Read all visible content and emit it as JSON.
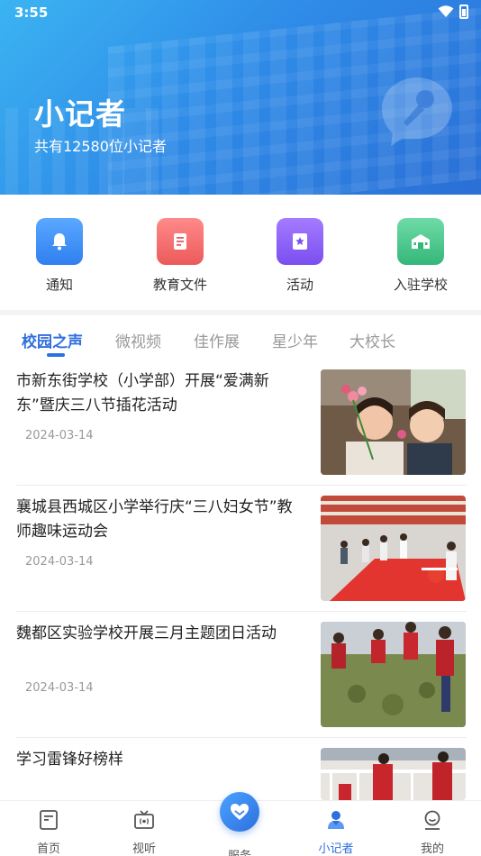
{
  "status_bar": {
    "time": "3:55"
  },
  "header": {
    "title": "小记者",
    "subtitle": "共有12580位小记者"
  },
  "quick_links": [
    {
      "label": "通知",
      "icon": "bell-icon",
      "color": "#3b8cf0"
    },
    {
      "label": "教育文件",
      "icon": "document-icon",
      "color": "#f06a6a"
    },
    {
      "label": "活动",
      "icon": "star-bookmark-icon",
      "color": "#8a5cf0"
    },
    {
      "label": "入驻学校",
      "icon": "school-icon",
      "color": "#3fc48a"
    }
  ],
  "tabs": [
    {
      "label": "校园之声",
      "active": true
    },
    {
      "label": "微视频",
      "active": false
    },
    {
      "label": "佳作展",
      "active": false
    },
    {
      "label": "星少年",
      "active": false
    },
    {
      "label": "大校长",
      "active": false
    }
  ],
  "news": [
    {
      "title": "市新东街学校（小学部）开展“爱满新东”暨庆三八节插花活动",
      "date": "2024-03-14",
      "image": "two-women-holding-flowers"
    },
    {
      "title": "襄城县西城区小学举行庆“三八妇女节”教师趣味运动会",
      "date": "2024-03-14",
      "image": "teachers-on-red-carpet-game"
    },
    {
      "title": "魏都区实验学校开展三月主题团日活动",
      "date": "2024-03-14",
      "image": "students-planting-in-field"
    },
    {
      "title": "学习雷锋好榜样",
      "date": "",
      "image": "students-cleaning-railing"
    }
  ],
  "bottom_nav": [
    {
      "label": "首页",
      "icon": "home-doc-icon",
      "active": false
    },
    {
      "label": "视听",
      "icon": "tv-icon",
      "active": false
    },
    {
      "label": "服务",
      "icon": "heart-hands-icon",
      "active": false
    },
    {
      "label": "小记者",
      "icon": "reporter-icon",
      "active": true
    },
    {
      "label": "我的",
      "icon": "user-icon",
      "active": false
    }
  ],
  "colors": {
    "accent": "#2f6fde",
    "header_start": "#3bb4f2",
    "header_end": "#2a6fd6"
  }
}
